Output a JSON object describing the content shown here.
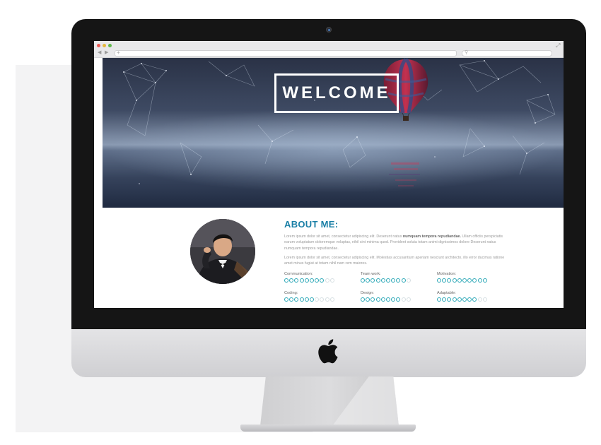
{
  "hero": {
    "welcome": "WELCOME"
  },
  "about": {
    "title": "ABOUT ME:",
    "para1_a": "Lorem ipsum dolor sit amet, consectetur adipiscing elit. Deserunt natus ",
    "para1_bold": "numquam tempora repudiandae.",
    "para1_b": " Ullam officiis perspiciatis earum voluptatum doloremque voluptas, nihil sint minima quod. Provident soluta totam animi dignissimos dolore Deserunt natus numquam tempora repudiandae.",
    "para2": "Lorem ipsum dolor sit amet, consectetur adipiscing elit. Molestias accusantium aperiam nesciunt architecto, illo error ducimus ratione amet minus fugiat at totam nihil nam rem maiores."
  },
  "skills": [
    {
      "label": "Communication:",
      "rating": 8,
      "max": 10
    },
    {
      "label": "Team work:",
      "rating": 9,
      "max": 10
    },
    {
      "label": "Motivation:",
      "rating": 10,
      "max": 10
    },
    {
      "label": "Coding:",
      "rating": 6,
      "max": 10
    },
    {
      "label": "Design:",
      "rating": 8,
      "max": 10
    },
    {
      "label": "Adaptable:",
      "rating": 8,
      "max": 10
    }
  ],
  "colors": {
    "accent": "#1a7fa6",
    "skill_dot": "#2aa7b6",
    "window_close": "#ec5b55",
    "window_minimize": "#e5b83c",
    "window_zoom": "#5fb94b"
  },
  "icons": [
    "webcam-icon",
    "apple-logo-icon",
    "back-icon",
    "forward-icon",
    "new-tab-icon",
    "search-icon",
    "fullscreen-icon"
  ]
}
